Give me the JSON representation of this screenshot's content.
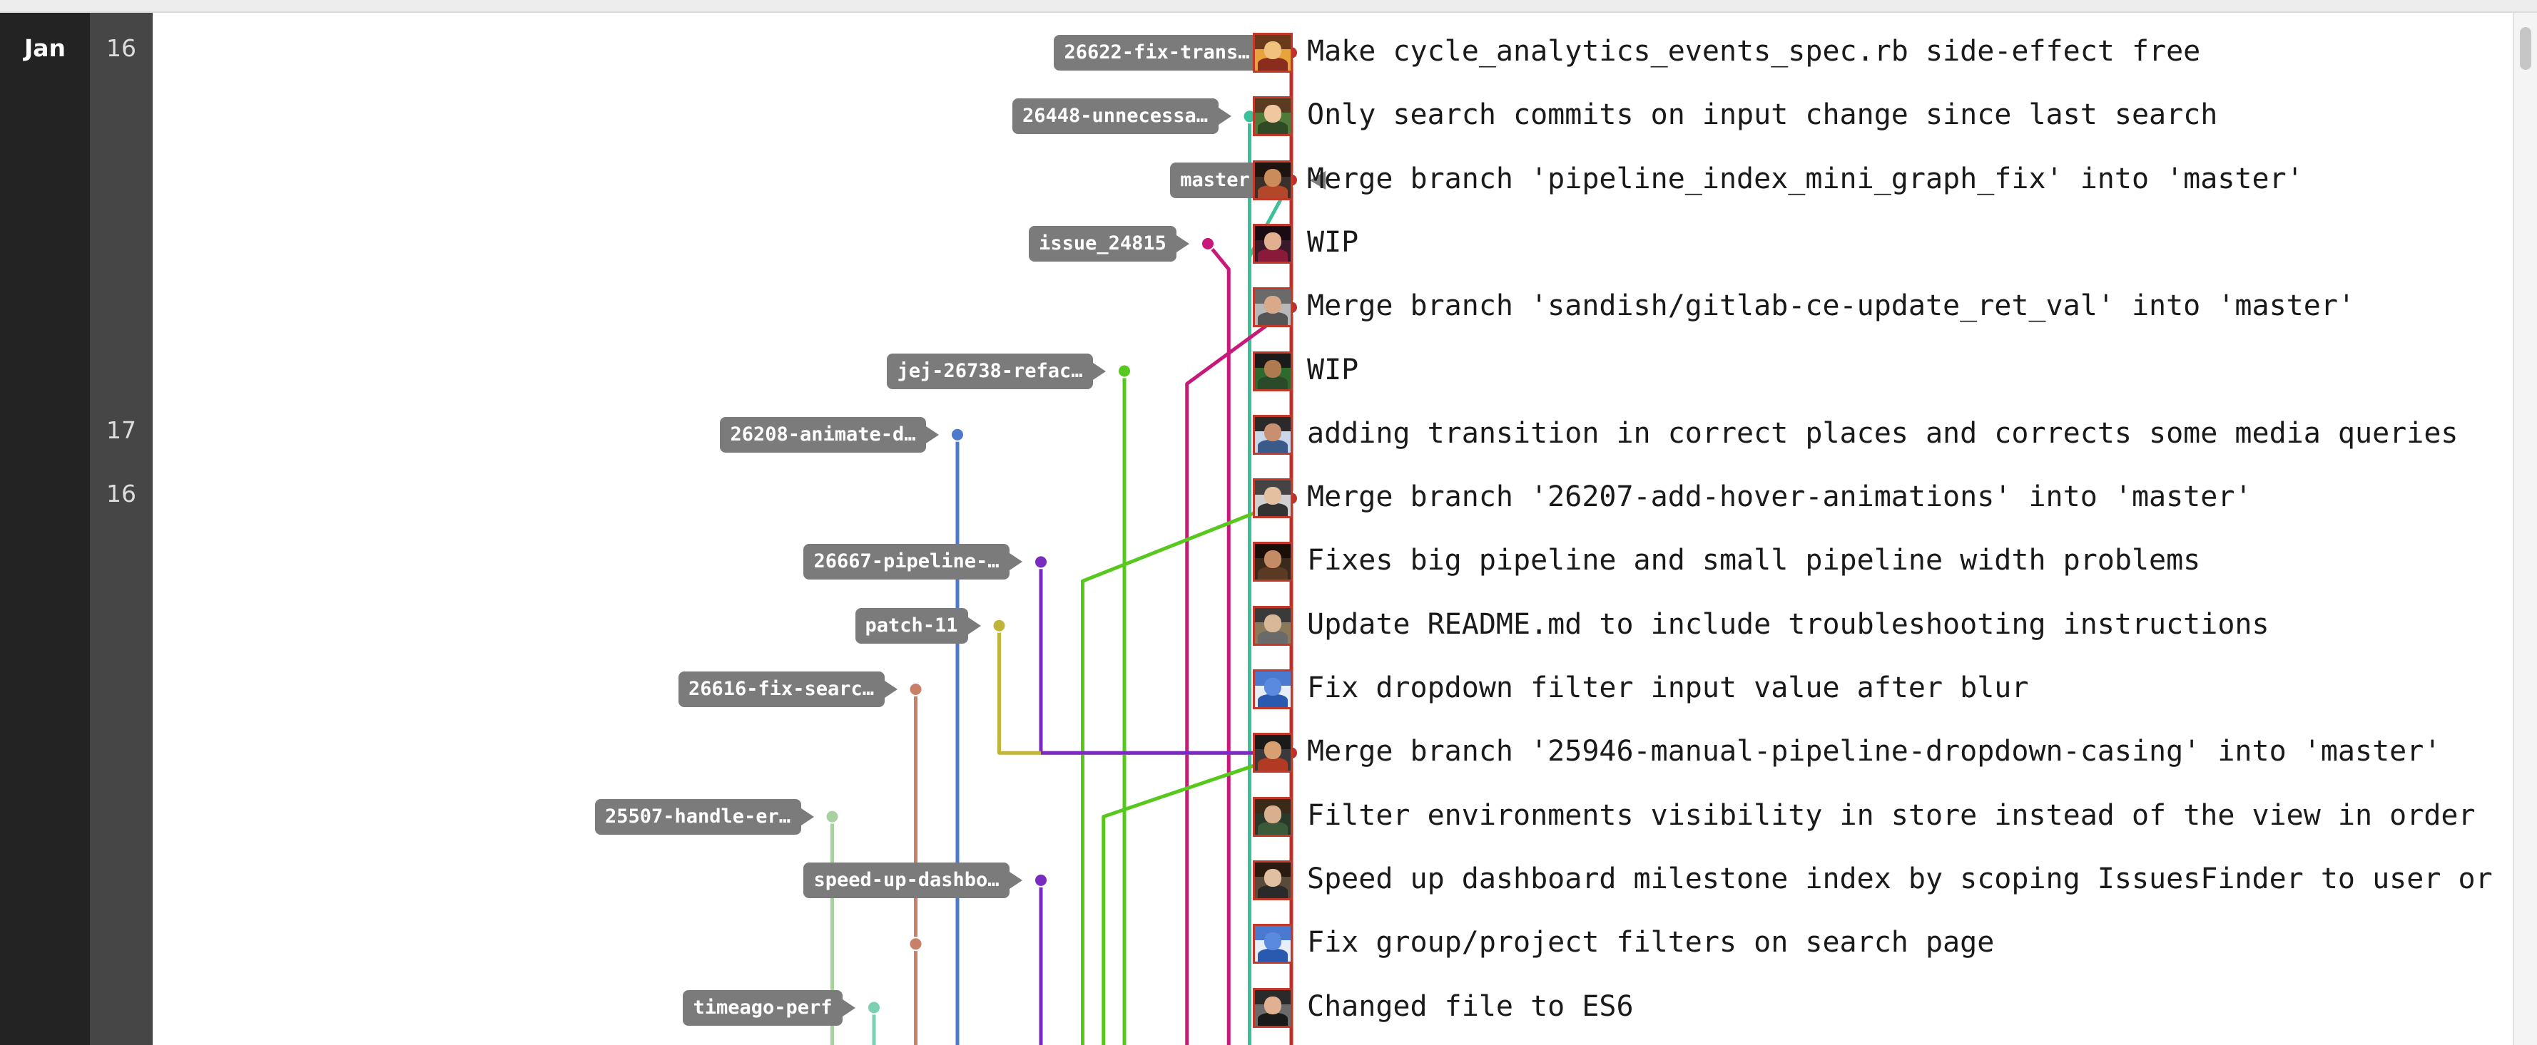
{
  "dates": {
    "month": "Jan",
    "days": [
      {
        "row": 0,
        "day": "16"
      },
      {
        "row": 6,
        "day": "17"
      },
      {
        "row": 7,
        "day": "16"
      }
    ]
  },
  "commits": [
    {
      "message": "Make cycle_analytics_events_spec.rb side-effect free",
      "avatar": {
        "bg": "#e8a33c",
        "hair": "#6a3a1a",
        "skin": "#f1c27d",
        "shirt": "#8a2c1e"
      }
    },
    {
      "message": "Only search commits on input change since last search",
      "avatar": {
        "bg": "#4f7a3a",
        "hair": "#5a3b22",
        "skin": "#f0c8a0",
        "shirt": "#2f4a24"
      }
    },
    {
      "message": "Merge branch 'pipeline_index_mini_graph_fix' into 'master'",
      "avatar": {
        "bg": "#3b2f2a",
        "hair": "#1e140f",
        "skin": "#c98c5a",
        "shirt": "#b2472a"
      }
    },
    {
      "message": "WIP",
      "avatar": {
        "bg": "#3a1a2a",
        "hair": "#1a0a12",
        "skin": "#e0b090",
        "shirt": "#8a1a3a"
      }
    },
    {
      "message": "Merge branch 'sandish/gitlab-ce-update_ret_val' into 'master'",
      "avatar": {
        "bg": "#b8b8b8",
        "hair": "#6a6a6a",
        "skin": "#d9a98a",
        "shirt": "#555555"
      }
    },
    {
      "message": "WIP",
      "avatar": {
        "bg": "#2e6a2e",
        "hair": "#1a1a1a",
        "skin": "#b07a50",
        "shirt": "#2a4a2a"
      }
    },
    {
      "message": "adding transition in correct places and corrects some media queries",
      "avatar": {
        "bg": "#c8d8ea",
        "hair": "#2a2a2a",
        "skin": "#c89070",
        "shirt": "#3a5a8a"
      }
    },
    {
      "message": "Merge branch '26207-add-hover-animations' into 'master'",
      "avatar": {
        "bg": "#d0d0d0",
        "hair": "#444444",
        "skin": "#e4c0a0",
        "shirt": "#333333"
      }
    },
    {
      "message": "Fixes big pipeline and small pipeline width problems",
      "avatar": {
        "bg": "#3a2a1a",
        "hair": "#1a0f08",
        "skin": "#c48c66",
        "shirt": "#5a3a22"
      }
    },
    {
      "message": "Update README.md to include troubleshooting instructions",
      "avatar": {
        "bg": "#8a7a5a",
        "hair": "#3a3a3a",
        "skin": "#d8b898",
        "shirt": "#6a6a6a"
      }
    },
    {
      "message": "Fix dropdown filter input value after blur",
      "avatar": {
        "bg": "#e8eef8",
        "hair": "#4a7ad0",
        "skin": "#5a8ae0",
        "shirt": "#2a5ab0"
      }
    },
    {
      "message": "Merge branch '25946-manual-pipeline-dropdown-casing' into 'master'",
      "avatar": {
        "bg": "#3a3a3a",
        "hair": "#1a1a1a",
        "skin": "#d8a070",
        "shirt": "#b03a22"
      }
    },
    {
      "message": "Filter environments visibility in store instead of the view in order",
      "avatar": {
        "bg": "#2a3a2a",
        "hair": "#3a2a1a",
        "skin": "#d8b090",
        "shirt": "#3a5a3a"
      }
    },
    {
      "message": "Speed up dashboard milestone index by scoping IssuesFinder to user or",
      "avatar": {
        "bg": "#5a4a3a",
        "hair": "#2a1a0f",
        "skin": "#e0c0a0",
        "shirt": "#2a2a2a"
      }
    },
    {
      "message": "Fix group/project filters on search page",
      "avatar": {
        "bg": "#e8eef8",
        "hair": "#4a7ad0",
        "skin": "#5a8ae0",
        "shirt": "#2a5ab0"
      }
    },
    {
      "message": "Changed file to ES6",
      "avatar": {
        "bg": "#6a6a6a",
        "hair": "#2a2a2a",
        "skin": "#e0b090",
        "shirt": "#1a1a1a"
      }
    }
  ],
  "branches": [
    {
      "name": "26622-fix-trans…",
      "row": 0,
      "column": 8,
      "color": "#c0302a"
    },
    {
      "name": "26448-unnecessa…",
      "row": 1,
      "column": 7,
      "color": "#3cc09a"
    },
    {
      "name": "master",
      "row": 2,
      "column": 8,
      "color": "#c0302a",
      "head": true
    },
    {
      "name": "issue_24815",
      "row": 3,
      "column": 6,
      "color": "#c8187a"
    },
    {
      "name": "jej-26738-refac…",
      "row": 5,
      "column": 4,
      "color": "#58c81e"
    },
    {
      "name": "26208-animate-d…",
      "row": 6,
      "column": 0,
      "color": "#4e7acb"
    },
    {
      "name": "26667-pipeline-…",
      "row": 8,
      "column": 2,
      "color": "#7a2ac0"
    },
    {
      "name": "patch-11",
      "row": 9,
      "column": 1,
      "color": "#c0b43a"
    },
    {
      "name": "26616-fix-searc…",
      "row": 10,
      "column": -1,
      "color": "#c8806a"
    },
    {
      "name": "25507-handle-er…",
      "row": 12,
      "column": -3,
      "color": "#a8d0a0"
    },
    {
      "name": "speed-up-dashbo…",
      "row": 13,
      "column": 2,
      "color": "#7a2ac0"
    },
    {
      "name": "timeago-perf",
      "row": 15,
      "column": -2,
      "color": "#7ad0b0"
    }
  ],
  "lines": [
    {
      "color": "#c0302a",
      "points": [
        [
          8,
          0
        ],
        [
          8,
          16
        ]
      ]
    },
    {
      "color": "#3cc09a",
      "points": [
        [
          7,
          1
        ],
        [
          7,
          16
        ]
      ]
    },
    {
      "color": "#3cc09a",
      "points": [
        [
          7,
          3.2
        ],
        [
          8,
          2
        ]
      ]
    },
    {
      "color": "#c8187a",
      "points": [
        [
          6,
          3
        ],
        [
          6.5,
          3.4
        ],
        [
          6.5,
          16
        ]
      ]
    },
    {
      "color": "#c8187a",
      "points": [
        [
          5.5,
          16
        ],
        [
          5.5,
          5.2
        ],
        [
          8,
          4
        ]
      ]
    },
    {
      "color": "#58c81e",
      "points": [
        [
          4,
          5
        ],
        [
          4,
          16
        ]
      ]
    },
    {
      "color": "#4e7acb",
      "points": [
        [
          0,
          6
        ],
        [
          0,
          16
        ]
      ]
    },
    {
      "color": "#58c81e",
      "points": [
        [
          3,
          16
        ],
        [
          3,
          8.3
        ],
        [
          8,
          7
        ]
      ]
    },
    {
      "color": "#7a2ac0",
      "points": [
        [
          2,
          8
        ],
        [
          2,
          11
        ]
      ]
    },
    {
      "color": "#c0b43a",
      "points": [
        [
          1,
          9
        ],
        [
          1,
          11
        ],
        [
          8,
          11
        ]
      ]
    },
    {
      "color": "#7a2ac0",
      "points": [
        [
          2,
          11
        ],
        [
          8,
          11
        ]
      ]
    },
    {
      "color": "#58c81e",
      "points": [
        [
          3.5,
          16
        ],
        [
          3.5,
          12
        ],
        [
          8,
          11
        ]
      ]
    },
    {
      "color": "#c8806a",
      "points": [
        [
          -1,
          10
        ],
        [
          -1,
          16
        ]
      ]
    },
    {
      "color": "#a8d0a0",
      "points": [
        [
          -3,
          12
        ],
        [
          -3,
          16
        ]
      ]
    },
    {
      "color": "#7a2ac0",
      "points": [
        [
          2,
          13
        ],
        [
          2,
          16
        ]
      ]
    },
    {
      "color": "#7ad0b0",
      "points": [
        [
          -2,
          15
        ],
        [
          -2,
          16
        ]
      ]
    }
  ],
  "commit_dots": [
    {
      "row": 0,
      "column": 8,
      "color": "#c0302a"
    },
    {
      "row": 1,
      "column": 7,
      "color": "#3cc09a"
    },
    {
      "row": 2,
      "column": 8,
      "color": "#c0302a"
    },
    {
      "row": 3,
      "column": 6,
      "color": "#c8187a"
    },
    {
      "row": 4,
      "column": 8,
      "color": "#c0302a"
    },
    {
      "row": 5,
      "column": 4,
      "color": "#58c81e"
    },
    {
      "row": 6,
      "column": 0,
      "color": "#4e7acb"
    },
    {
      "row": 7,
      "column": 8,
      "color": "#c0302a"
    },
    {
      "row": 8,
      "column": 2,
      "color": "#7a2ac0"
    },
    {
      "row": 9,
      "column": 1,
      "color": "#c0b43a"
    },
    {
      "row": 10,
      "column": -1,
      "color": "#c8806a"
    },
    {
      "row": 11,
      "column": 8,
      "color": "#c0302a"
    },
    {
      "row": 12,
      "column": -3,
      "color": "#a8d0a0"
    },
    {
      "row": 13,
      "column": 2,
      "color": "#7a2ac0"
    },
    {
      "row": 14,
      "column": -1,
      "color": "#c8806a"
    },
    {
      "row": 15,
      "column": -2,
      "color": "#7ad0b0"
    }
  ]
}
